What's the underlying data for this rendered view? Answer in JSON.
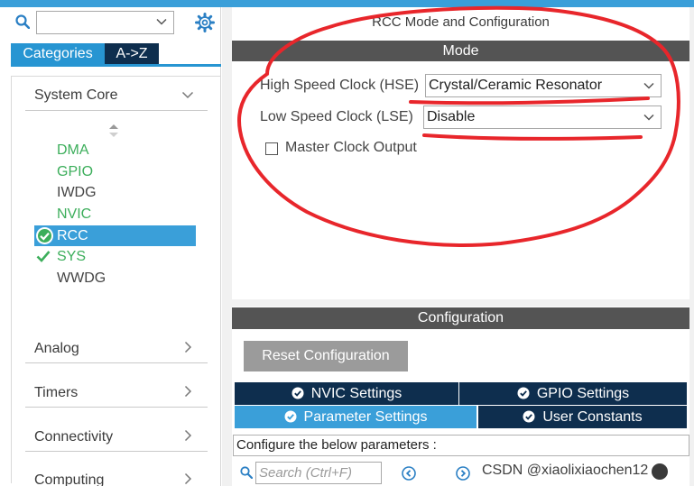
{
  "left_panel": {
    "search": {
      "value": ""
    },
    "tabs": [
      {
        "label": "Categories"
      },
      {
        "label": "A->Z"
      }
    ],
    "system_core": {
      "label": "System Core",
      "items": [
        {
          "label": "DMA"
        },
        {
          "label": "GPIO"
        },
        {
          "label": "IWDG"
        },
        {
          "label": "NVIC"
        },
        {
          "label": "RCC"
        },
        {
          "label": "SYS"
        },
        {
          "label": "WWDG"
        }
      ]
    },
    "categories": [
      {
        "label": "Analog"
      },
      {
        "label": "Timers"
      },
      {
        "label": "Connectivity"
      },
      {
        "label": "Computing"
      }
    ]
  },
  "mode_panel": {
    "title": "RCC Mode and Configuration",
    "section": "Mode",
    "hse": {
      "label": "High Speed Clock (HSE)",
      "value": "Crystal/Ceramic Resonator"
    },
    "lse": {
      "label": "Low Speed Clock (LSE)",
      "value": "Disable"
    },
    "mco": {
      "label": "Master Clock Output",
      "checked": false
    }
  },
  "config_panel": {
    "section": "Configuration",
    "reset_label": "Reset Configuration",
    "tabs": [
      {
        "label": "NVIC Settings"
      },
      {
        "label": "GPIO Settings"
      },
      {
        "label": "Parameter Settings"
      },
      {
        "label": "User Constants"
      }
    ],
    "hint": "Configure the below parameters :",
    "search_placeholder": "Search (Ctrl+F)"
  },
  "watermark": "CSDN @xiaolixiaochen12",
  "colors": {
    "accent": "#3a9fd9",
    "dark_tab": "#0e2e4e",
    "green": "#3cae5b",
    "section_bar": "#545454",
    "annotation": "#e8262b"
  }
}
